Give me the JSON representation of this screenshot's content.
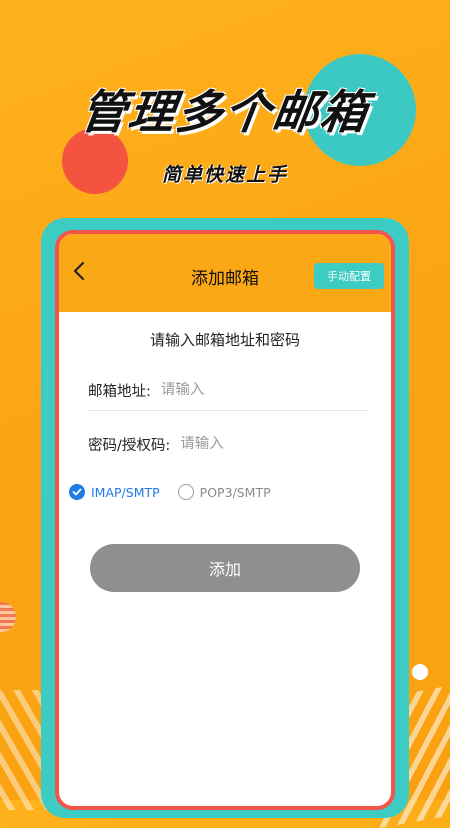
{
  "hero": {
    "title": "管理多个邮箱",
    "subtitle": "简单快速上手"
  },
  "header": {
    "title": "添加邮箱",
    "back_icon": "chevron-left-icon",
    "manual_button": "手动配置"
  },
  "form": {
    "prompt": "请输入邮箱地址和密码",
    "email_label": "邮箱地址:",
    "email_placeholder": "请输入",
    "email_value": "",
    "password_label": "密码/授权码:",
    "password_placeholder": "请输入",
    "password_value": ""
  },
  "protocol": {
    "options": [
      {
        "label": "IMAP/SMTP",
        "selected": true
      },
      {
        "label": "POP3/SMTP",
        "selected": false
      }
    ]
  },
  "submit": {
    "label": "添加"
  },
  "colors": {
    "background": "#FBA817",
    "teal_accent": "#3DCCC4",
    "red_accent": "#F2554A",
    "radio_selected": "#1E7BE5",
    "button_disabled": "#8F8F8F"
  }
}
